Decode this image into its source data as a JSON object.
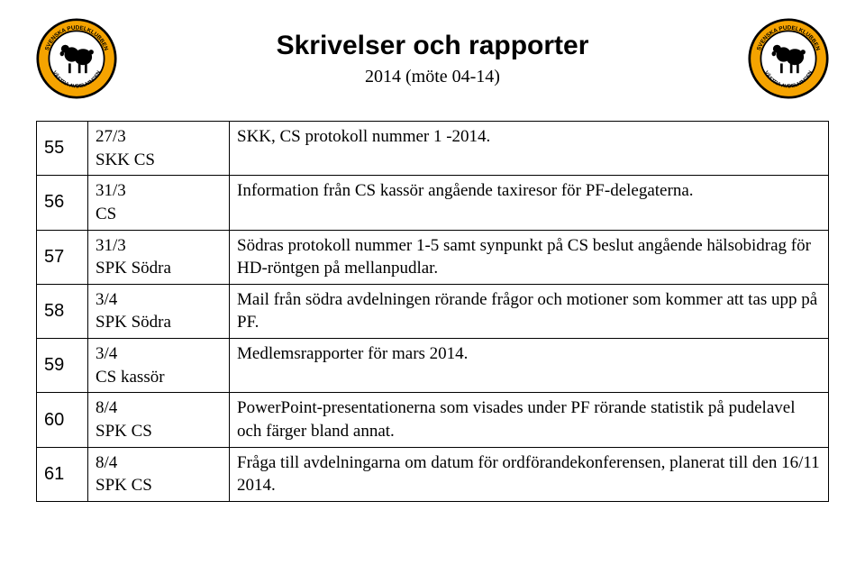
{
  "title": "Skrivelser och rapporter",
  "subtitle": "2014 (möte 04-14)",
  "logo": {
    "upper_text": "SVENSKA PUDELKLUBBEN",
    "lower_text": "VÄSTRA AVDELNINGEN",
    "bg": "#f5a300",
    "ring": "#000000"
  },
  "rows": [
    {
      "n": "55",
      "date": "27/3",
      "from": "SKK CS",
      "text": "SKK, CS protokoll nummer 1 -2014."
    },
    {
      "n": "56",
      "date": "31/3",
      "from": "CS",
      "text": "Information från CS kassör angående taxiresor för PF-delegaterna."
    },
    {
      "n": "57",
      "date": "31/3",
      "from": "SPK Södra",
      "text": "Södras protokoll nummer 1-5 samt synpunkt på CS beslut angående hälsobidrag för HD-röntgen på mellanpudlar."
    },
    {
      "n": "58",
      "date": "3/4",
      "from": "SPK Södra",
      "text": "Mail från södra avdelningen rörande frågor och motioner som kommer att tas upp på PF."
    },
    {
      "n": "59",
      "date": "3/4",
      "from": "CS kassör",
      "text": "Medlemsrapporter för mars 2014."
    },
    {
      "n": "60",
      "date": "8/4",
      "from": "SPK CS",
      "text": "PowerPoint-presentationerna som visades under PF rörande statistik på pudelavel och färger bland annat."
    },
    {
      "n": "61",
      "date": "8/4",
      "from": "SPK CS",
      "text": "Fråga till avdelningarna om datum för ordförandekonferensen, planerat till den 16/11 2014."
    }
  ]
}
